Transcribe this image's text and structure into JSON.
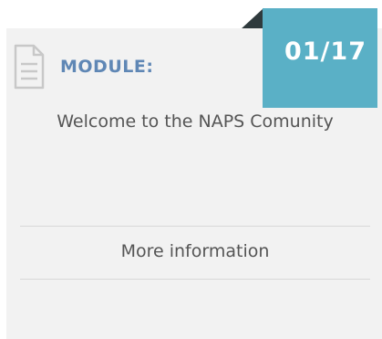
{
  "module": {
    "label": "MODULE:",
    "counter": "01/17",
    "title": "Welcome to the NAPS Comunity",
    "more_link": "More information",
    "icon": "document-icon"
  },
  "colors": {
    "badge": "#5ab0c6",
    "label": "#5f87b5",
    "text": "#555555",
    "card": "#f2f2f2"
  }
}
